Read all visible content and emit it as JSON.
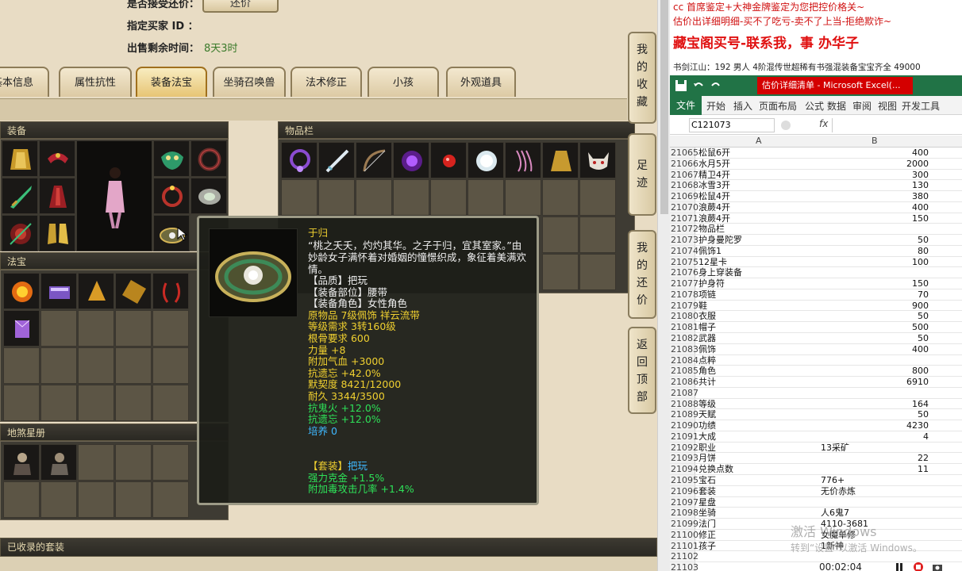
{
  "game": {
    "labels": {
      "accept_bargain": "是否接受还价：",
      "designated_buyer": "指定买家 ID ：",
      "remaining_time": "出售剩余时间：",
      "remaining_time_value": "8天3时"
    },
    "bargain_button": "还价",
    "tabs": [
      "基本信息",
      "属性抗性",
      "装备法宝",
      "坐骑召唤兽",
      "法术修正",
      "小孩",
      "外观道具"
    ],
    "sections": {
      "equipment": "装备",
      "inventory": "物品栏",
      "treasure": "法宝",
      "stars": "地煞星册",
      "collected_sets": "已收录的套装"
    },
    "side_buttons": [
      [
        "我",
        "的",
        "收",
        "藏"
      ],
      [
        "足",
        "迹"
      ],
      [
        "我",
        "的",
        "还",
        "价"
      ],
      [
        "返",
        "回",
        "顶",
        "部"
      ]
    ],
    "tooltip": {
      "name": "于归",
      "desc1": "“桃之夭夭，灼灼其华。之子于归，宜其室家。”由",
      "desc2": "妙龄女子满怀着对婚姻的憧憬织成，象征着美满欢",
      "desc3": "情。",
      "quality": "【品质】把玩",
      "slot": "【装备部位】腰带",
      "role": "【装备角色】女性角色",
      "origin": "原物品 7级佩饰 祥云流带",
      "level_req": "等级需求 3转160级",
      "bone_req": "根骨要求 600",
      "strength": "力量 +8",
      "hp": "附加气血 +3000",
      "resist_forget": "抗遗忘 +42.0%",
      "tacit": "默契度 8421/12000",
      "durability": "耐久 3344/3500",
      "resist_ghost_fire": "抗鬼火 +12.0%",
      "resist_forget2": "抗遗忘 +12.0%",
      "cultivate": "培养 0",
      "set_label": "【套装】",
      "set_name": "把玩",
      "set_bonus1": "强力克金 +1.5%",
      "set_bonus2": "附加毒攻击几率 +1.4%"
    }
  },
  "right": {
    "ad1": "cc 首席鉴定+大神金牌鉴定为您把控价格关~",
    "ad2": "估价出详细明细-买不了吃亏-卖不了上当-拒绝欺诈~",
    "ad3": "藏宝阁买号-联系我，事   办华子",
    "ad4": "书剑江山：192 男人 4阶混传世超稀有书强混装备宝宝齐全 49000",
    "excel_title": "估价详细清单 - Microsoft Excel(...",
    "ribbon": [
      "文件",
      "开始",
      "插入",
      "页面布局",
      "公式",
      "数据",
      "审阅",
      "视图",
      "开发工具"
    ],
    "namebox": "C121073",
    "fx": "fx",
    "col_a": "A",
    "col_b": "B",
    "rows": [
      [
        "21065",
        "松鼠6开",
        "400"
      ],
      [
        "21066",
        "水月5开",
        "2000"
      ],
      [
        "21067",
        "精卫4开",
        "300"
      ],
      [
        "21068",
        "冰雪3开",
        "130"
      ],
      [
        "21069",
        "松鼠4开",
        "380"
      ],
      [
        "21070",
        "浪蕨4开",
        "400"
      ],
      [
        "21071",
        "浪蕨4开",
        "150"
      ],
      [
        "21072",
        "物品栏",
        ""
      ],
      [
        "21073",
        "护身曼陀罗",
        "50"
      ],
      [
        "21074",
        "佩饰1",
        "80"
      ],
      [
        "21075",
        "12星卡",
        "100"
      ],
      [
        "21076",
        "身上穿装备",
        ""
      ],
      [
        "21077",
        "护身符",
        "150"
      ],
      [
        "21078",
        "项链",
        "70"
      ],
      [
        "21079",
        "鞋",
        "900"
      ],
      [
        "21080",
        "衣服",
        "50"
      ],
      [
        "21081",
        "帽子",
        "500"
      ],
      [
        "21082",
        "武器",
        "50"
      ],
      [
        "21083",
        "佩饰",
        "400"
      ],
      [
        "21084",
        "点粹",
        ""
      ],
      [
        "21085",
        "角色",
        "800"
      ],
      [
        "21086",
        "共计",
        "6910"
      ],
      [
        "21087",
        "",
        ""
      ],
      [
        "21088",
        "等级",
        "164"
      ],
      [
        "21089",
        "天赋",
        "50"
      ],
      [
        "21090",
        "功绩",
        "4230"
      ],
      [
        "21091",
        "大成",
        "4"
      ],
      [
        "21092",
        "职业",
        "13采矿"
      ],
      [
        "21093",
        "月饼",
        "22"
      ],
      [
        "21094",
        "兑换点数",
        "11"
      ],
      [
        "21095",
        "宝石",
        "776+"
      ],
      [
        "21096",
        "套装",
        "无价赤炼"
      ],
      [
        "21097",
        "星盘",
        ""
      ],
      [
        "21098",
        "坐骑",
        "人6鬼7"
      ],
      [
        "21099",
        "法门",
        "4110-3681"
      ],
      [
        "21100",
        "修正",
        "女魔单修"
      ],
      [
        "21101",
        "孩子",
        "1新神"
      ],
      [
        "21102",
        "",
        ""
      ],
      [
        "21103",
        "",
        ""
      ]
    ],
    "watermark": "激活 Windows",
    "watermark2": "转到“设置”以激活 Windows。",
    "timer": "00:02:04"
  }
}
